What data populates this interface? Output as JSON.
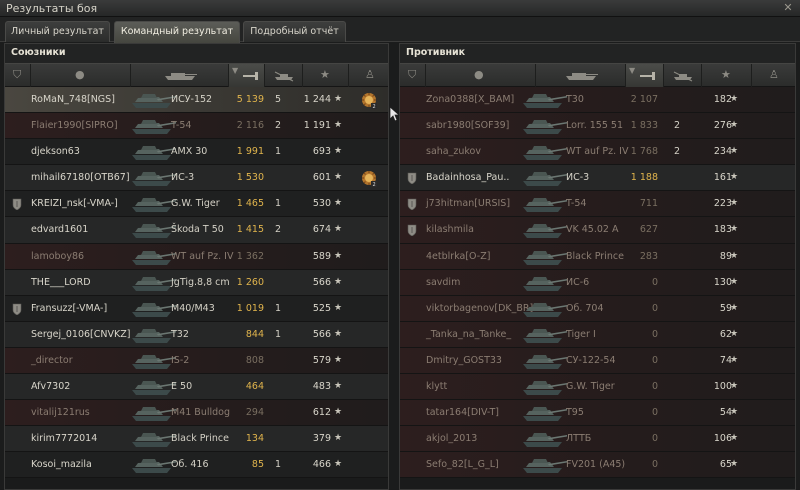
{
  "window": {
    "title": "Результаты боя",
    "close_glyph": "✕"
  },
  "tabs": [
    {
      "label": "Личный результат",
      "active": false
    },
    {
      "label": "Командный результат",
      "active": true
    },
    {
      "label": "Подробный отчёт",
      "active": false
    }
  ],
  "columns": [
    {
      "key": "clan",
      "icon": "shield-icon"
    },
    {
      "key": "player",
      "icon": "player-icon"
    },
    {
      "key": "tank",
      "icon": "tank-icon"
    },
    {
      "key": "damage",
      "icon": "damage-icon",
      "sorted": true
    },
    {
      "key": "frags",
      "icon": "frags-icon"
    },
    {
      "key": "xp",
      "icon": "star-icon"
    },
    {
      "key": "medal",
      "icon": "medal-icon"
    }
  ],
  "allies": {
    "title": "Союзники",
    "rows": [
      {
        "clan": false,
        "name": "RoMaN_748[NGS]",
        "tank": "ИСУ-152",
        "damage": "5 139",
        "frags": "5",
        "xp": "1 244",
        "medal": true,
        "state": "self"
      },
      {
        "clan": false,
        "name": "Flaier1990[SIPRO]",
        "tank": "T-54",
        "damage": "2 116",
        "frags": "2",
        "xp": "1 191",
        "medal": false,
        "state": "dead"
      },
      {
        "clan": false,
        "name": "djekson63",
        "tank": "AMX 30",
        "damage": "1 991",
        "frags": "1",
        "xp": "693",
        "medal": false,
        "state": "alive"
      },
      {
        "clan": false,
        "name": "mihail67180[OTB67]",
        "tank": "ИС-3",
        "damage": "1 530",
        "frags": "",
        "xp": "601",
        "medal": true,
        "state": "alive"
      },
      {
        "clan": true,
        "name": "KREIZI_nsk[-VMA-]",
        "tank": "G.W. Tiger",
        "damage": "1 465",
        "frags": "1",
        "xp": "530",
        "medal": false,
        "state": "alive"
      },
      {
        "clan": false,
        "name": "edvard1601",
        "tank": "Škoda T 50",
        "damage": "1 415",
        "frags": "2",
        "xp": "674",
        "medal": false,
        "state": "alive"
      },
      {
        "clan": false,
        "name": "lamoboy86",
        "tank": "WT auf Pz. IV",
        "damage": "1 362",
        "frags": "",
        "xp": "589",
        "medal": false,
        "state": "dead"
      },
      {
        "clan": false,
        "name": "THE___LORD",
        "tank": "JgTig.8,8 cm",
        "damage": "1 260",
        "frags": "",
        "xp": "566",
        "medal": false,
        "state": "alive"
      },
      {
        "clan": true,
        "name": "Fransuzz[-VMA-]",
        "tank": "M40/M43",
        "damage": "1 019",
        "frags": "1",
        "xp": "525",
        "medal": false,
        "state": "alive"
      },
      {
        "clan": false,
        "name": "Sergej_0106[CNVKZ]",
        "tank": "T32",
        "damage": "844",
        "frags": "1",
        "xp": "566",
        "medal": false,
        "state": "alive"
      },
      {
        "clan": false,
        "name": "_director",
        "tank": "IS-2",
        "damage": "808",
        "frags": "",
        "xp": "579",
        "medal": false,
        "state": "dead"
      },
      {
        "clan": false,
        "name": "Afv7302",
        "tank": "E 50",
        "damage": "464",
        "frags": "",
        "xp": "483",
        "medal": false,
        "state": "alive"
      },
      {
        "clan": false,
        "name": "vitalij121rus",
        "tank": "M41 Bulldog",
        "damage": "294",
        "frags": "",
        "xp": "612",
        "medal": false,
        "state": "dead"
      },
      {
        "clan": false,
        "name": "kirim7772014",
        "tank": "Black Prince",
        "damage": "134",
        "frags": "",
        "xp": "379",
        "medal": false,
        "state": "alive"
      },
      {
        "clan": false,
        "name": "Kosoi_mazila",
        "tank": "Об. 416",
        "damage": "85",
        "frags": "1",
        "xp": "466",
        "medal": false,
        "state": "alive"
      }
    ]
  },
  "enemies": {
    "title": "Противник",
    "rows": [
      {
        "clan": false,
        "name": "Zona0388[X_BAM]",
        "tank": "T30",
        "damage": "2 107",
        "frags": "",
        "xp": "182",
        "state": "dead"
      },
      {
        "clan": false,
        "name": "sabr1980[SOF39]",
        "tank": "Lorr. 155 51",
        "damage": "1 833",
        "frags": "2",
        "xp": "276",
        "state": "dead"
      },
      {
        "clan": false,
        "name": "saha_zukov",
        "tank": "WT auf Pz. IV",
        "damage": "1 768",
        "frags": "2",
        "xp": "234",
        "state": "dead"
      },
      {
        "clan": true,
        "name": "Badainhosa_Pau..",
        "tank": "ИС-3",
        "damage": "1 188",
        "frags": "",
        "xp": "161",
        "state": "alive"
      },
      {
        "clan": true,
        "name": "j73hitman[URSIS]",
        "tank": "T-54",
        "damage": "711",
        "frags": "",
        "xp": "223",
        "state": "dead"
      },
      {
        "clan": true,
        "name": "kilashmila",
        "tank": "VK 45.02 A",
        "damage": "627",
        "frags": "",
        "xp": "183",
        "state": "dead"
      },
      {
        "clan": false,
        "name": "4etblrka[O-Z]",
        "tank": "Black Prince",
        "damage": "283",
        "frags": "",
        "xp": "89",
        "state": "dead"
      },
      {
        "clan": false,
        "name": "savdim",
        "tank": "ИС-6",
        "damage": "0",
        "frags": "",
        "xp": "130",
        "state": "dead"
      },
      {
        "clan": false,
        "name": "viktorbagenov[DK_BR]",
        "tank": "Об. 704",
        "damage": "0",
        "frags": "",
        "xp": "59",
        "state": "dead"
      },
      {
        "clan": false,
        "name": "_Tanka_na_Tanke_",
        "tank": "Tiger I",
        "damage": "0",
        "frags": "",
        "xp": "62",
        "state": "dead"
      },
      {
        "clan": false,
        "name": "Dmitry_GOST33",
        "tank": "СУ-122-54",
        "damage": "0",
        "frags": "",
        "xp": "74",
        "state": "dead"
      },
      {
        "clan": false,
        "name": "klytt",
        "tank": "G.W. Tiger",
        "damage": "0",
        "frags": "",
        "xp": "100",
        "state": "dead"
      },
      {
        "clan": false,
        "name": "tatar164[DIV-T]",
        "tank": "T95",
        "damage": "0",
        "frags": "",
        "xp": "54",
        "state": "dead"
      },
      {
        "clan": false,
        "name": "akjol_2013",
        "tank": "ЛТТБ",
        "damage": "0",
        "frags": "",
        "xp": "106",
        "state": "dead"
      },
      {
        "clan": false,
        "name": "Sefo_82[L_G_L]",
        "tank": "FV201 (A45)",
        "damage": "0",
        "frags": "",
        "xp": "65",
        "state": "dead"
      }
    ]
  },
  "star_glyph": "★",
  "colors": {
    "damage": "#e0b44c",
    "dead_row": "#2d1e1e",
    "self_row": "#4a4740",
    "text": "#d9d6cb"
  }
}
